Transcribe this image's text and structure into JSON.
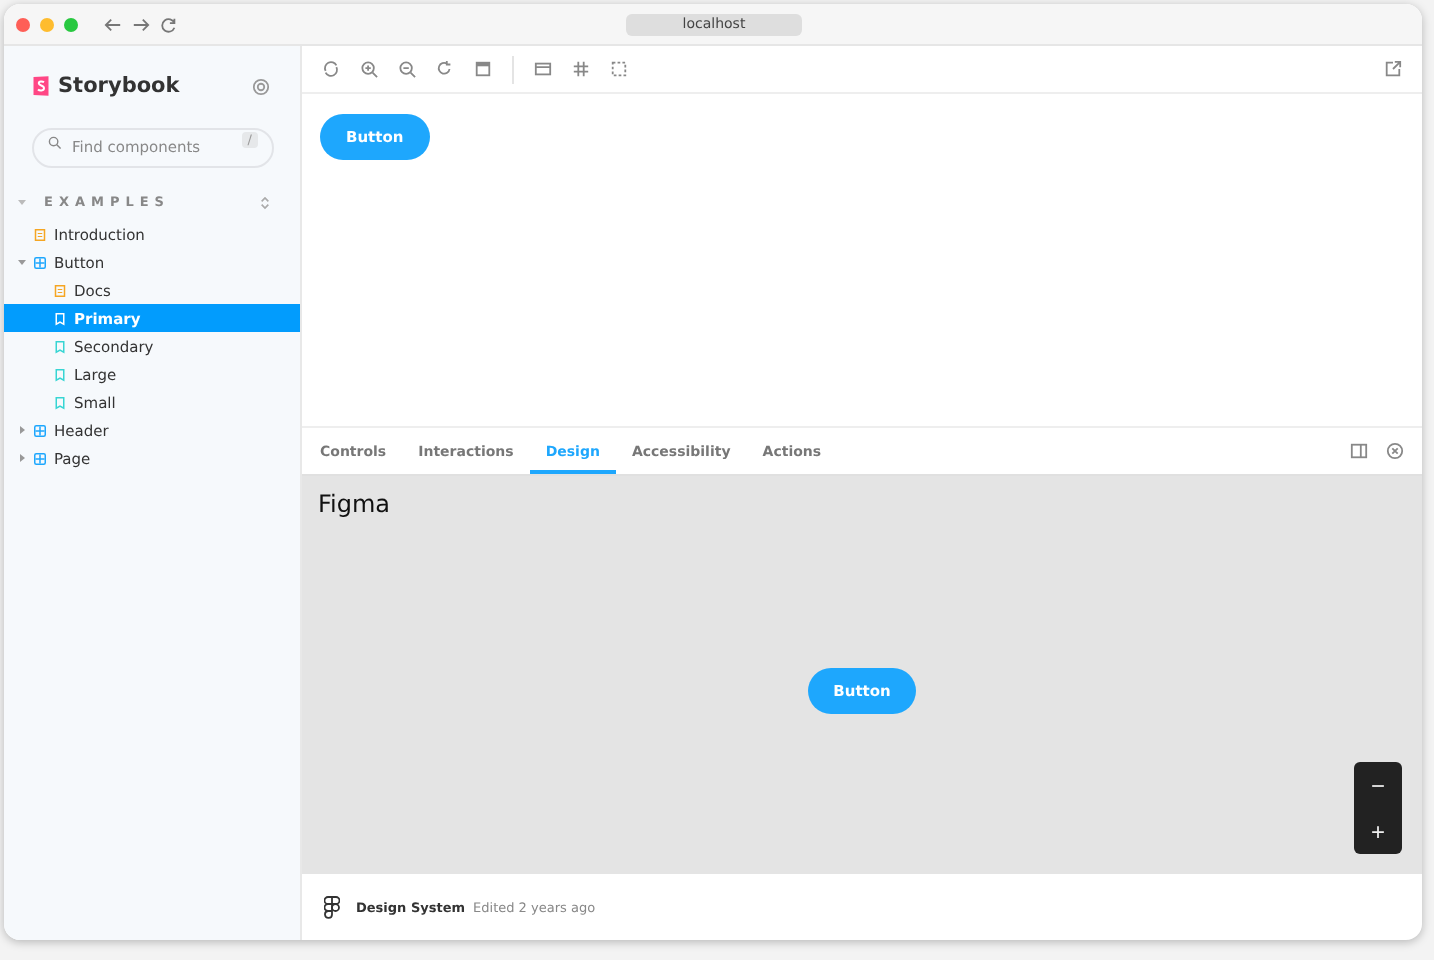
{
  "browser": {
    "address": "localhost"
  },
  "sidebar": {
    "brand": "Storybook",
    "search": {
      "placeholder": "Find components",
      "shortcut": "/"
    },
    "section": "EXAMPLES",
    "tree": [
      {
        "label": "Introduction",
        "kind": "docs",
        "selected": false
      },
      {
        "label": "Button",
        "kind": "component",
        "expanded": true,
        "selected": false,
        "children": [
          {
            "label": "Docs",
            "kind": "docs",
            "selected": false
          },
          {
            "label": "Primary",
            "kind": "story",
            "selected": true
          },
          {
            "label": "Secondary",
            "kind": "story",
            "selected": false
          },
          {
            "label": "Large",
            "kind": "story",
            "selected": false
          },
          {
            "label": "Small",
            "kind": "story",
            "selected": false
          }
        ]
      },
      {
        "label": "Header",
        "kind": "component",
        "expanded": false,
        "selected": false
      },
      {
        "label": "Page",
        "kind": "component",
        "expanded": false,
        "selected": false
      }
    ]
  },
  "preview": {
    "button": "Button"
  },
  "addons": {
    "tabs": [
      {
        "label": "Controls",
        "selected": false
      },
      {
        "label": "Interactions",
        "selected": false
      },
      {
        "label": "Design",
        "selected": true
      },
      {
        "label": "Accessibility",
        "selected": false
      },
      {
        "label": "Actions",
        "selected": false
      }
    ],
    "figma": {
      "title": "Figma",
      "button": "Button",
      "zoom_out": "−",
      "zoom_in": "+",
      "file": "Design System",
      "edited": "Edited 2 years ago"
    }
  }
}
